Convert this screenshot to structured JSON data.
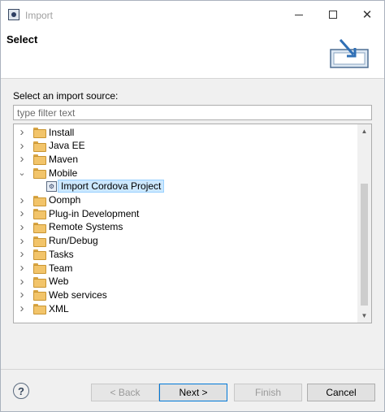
{
  "window": {
    "title": "Import"
  },
  "banner": {
    "title": "Select",
    "icon": "import-wizard-icon"
  },
  "prompt": "Select an import source:",
  "filter": {
    "placeholder": "type filter text",
    "value": ""
  },
  "tree": {
    "items": [
      {
        "label": "Install",
        "expanded": false
      },
      {
        "label": "Java EE",
        "expanded": false
      },
      {
        "label": "Maven",
        "expanded": false
      },
      {
        "label": "Mobile",
        "expanded": true
      },
      {
        "label": "Import Cordova Project",
        "child": true,
        "selected": true
      },
      {
        "label": "Oomph",
        "expanded": false
      },
      {
        "label": "Plug-in Development",
        "expanded": false
      },
      {
        "label": "Remote Systems",
        "expanded": false
      },
      {
        "label": "Run/Debug",
        "expanded": false
      },
      {
        "label": "Tasks",
        "expanded": false
      },
      {
        "label": "Team",
        "expanded": false
      },
      {
        "label": "Web",
        "expanded": false
      },
      {
        "label": "Web services",
        "expanded": false
      },
      {
        "label": "XML",
        "expanded": false
      }
    ]
  },
  "buttons": {
    "help": "?",
    "back": "< Back",
    "next": "Next >",
    "finish": "Finish",
    "cancel": "Cancel"
  },
  "colors": {
    "selection": "#cce8ff",
    "default_button_border": "#0078d7"
  }
}
